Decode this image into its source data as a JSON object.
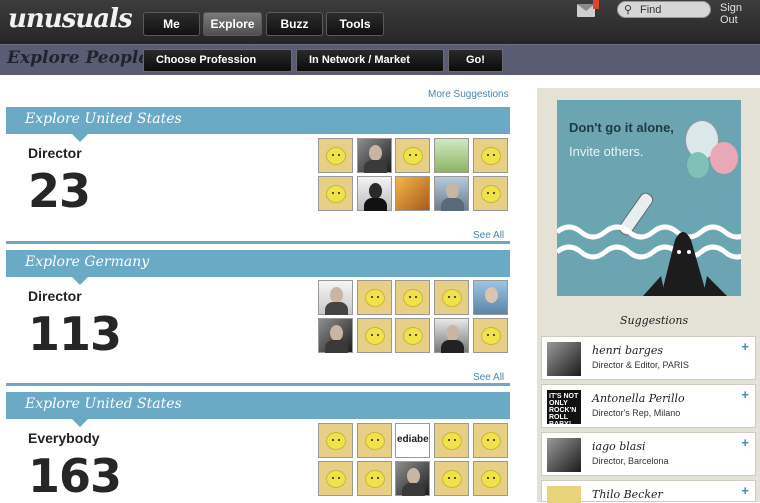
{
  "app": {
    "logo": "unusuals"
  },
  "nav": {
    "items": [
      {
        "label": "Me",
        "active": false
      },
      {
        "label": "Explore",
        "active": true
      },
      {
        "label": "Buzz",
        "active": false
      },
      {
        "label": "Tools",
        "active": false
      }
    ],
    "find_placeholder": "Find",
    "sign_out": "Sign Out"
  },
  "subnav": {
    "title": "Explore People",
    "choose_profession": "Choose Profession",
    "network_market": "In Network / Market",
    "go": "Go!"
  },
  "main": {
    "more_suggestions": "More Suggestions",
    "sections": [
      {
        "heading": "Explore United States",
        "role": "Director",
        "count": "23",
        "see_all": "See All"
      },
      {
        "heading": "Explore Germany",
        "role": "Director",
        "count": "113",
        "see_all": "See All"
      },
      {
        "heading": "Explore United States",
        "role": "Everybody",
        "count": "163"
      }
    ],
    "tile_text": "ediabe"
  },
  "sidebar": {
    "promo_line1": "Don't go it alone,",
    "promo_line2": "Invite others.",
    "suggestions_title": "Suggestions",
    "suggestions": [
      {
        "name": "henri barges",
        "desc": "Director & Editor, PARIS"
      },
      {
        "name": "Antonella Perillo",
        "desc": "Director's Rep, Milano",
        "thumb_text": "IT'S NOT ONLY ROCK'N ROLL BABY!"
      },
      {
        "name": "iago blasi",
        "desc": "Director, Barcelona"
      },
      {
        "name": "Thilo Becker",
        "desc": ""
      }
    ],
    "add_symbol": "+"
  },
  "colors": {
    "accent": "#6aaac5",
    "subbar": "#595c73",
    "duck_tile": "#e7cf86"
  }
}
